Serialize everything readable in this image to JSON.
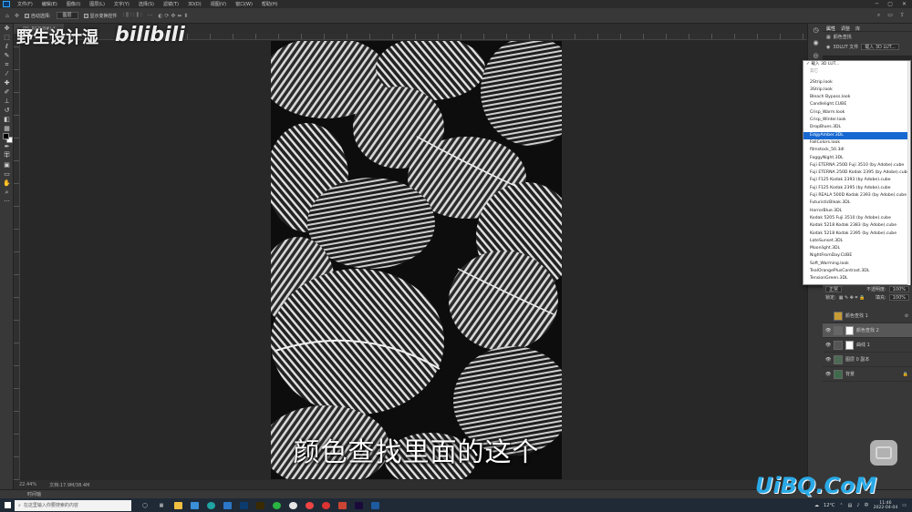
{
  "menu": {
    "items": [
      "文件(F)",
      "编辑(E)",
      "图像(I)",
      "图层(L)",
      "文字(Y)",
      "选择(S)",
      "滤镜(T)",
      "3D(D)",
      "视图(V)",
      "窗口(W)",
      "帮助(H)"
    ]
  },
  "options": {
    "auto_select": "自动选择:",
    "auto_select_value": "图层",
    "show_transform": "显示变换控件"
  },
  "document": {
    "tab": "0%,RGB/8#) *",
    "zoom": "22.44%",
    "doc_size": "文档:17.9M/38.4M"
  },
  "canvas": {
    "subtitle": "颜色查找里面的这个"
  },
  "watermark": {
    "channel": "野生设计湿",
    "bilibili": "bilibili",
    "site": "UiBQ.CoM"
  },
  "properties": {
    "tabs": [
      "属性",
      "调整",
      "库"
    ],
    "panel_title": "颜色查找",
    "lut_label": "3DLUT 文件",
    "lut_value": "载入 3D LUT..."
  },
  "dropdown": {
    "header_items": [
      "载入 3D LUT...",
      "其它"
    ],
    "items": [
      "2Strip.look",
      "3Strip.look",
      "Bleach Bypass.look",
      "Candlelight.CUBE",
      "Crisp_Warm.look",
      "Crisp_Winter.look",
      "DropBlues.3DL",
      "EdgyAmber.3DL",
      "FallColors.look",
      "filmstock_50.3dl",
      "FoggyNight.3DL",
      "Fuji ETERNA 250D Fuji 3510 (by Adobe).cube",
      "Fuji ETERNA 250D Kodak 2395 (by Adobe).cube",
      "Fuji F125 Kodak 2393 (by Adobe).cube",
      "Fuji F125 Kodak 2395 (by Adobe).cube",
      "Fuji REALA 500D Kodak 2393 (by Adobe).cube",
      "FuturisticBleak.3DL",
      "HorrorBlue.3DL",
      "Kodak 5205 Fuji 3510 (by Adobe).cube",
      "Kodak 5218 Kodak 2383 (by Adobe).cube",
      "Kodak 5218 Kodak 2395 (by Adobe).cube",
      "LateSunset.3DL",
      "Moonlight.3DL",
      "NightFromDay.CUBE",
      "Soft_Warming.look",
      "TealOrangePlusContrast.3DL",
      "TensionGreen.3DL"
    ],
    "highlighted_index": 7
  },
  "layers": {
    "blend_mode": "正常",
    "opacity_label": "不透明度:",
    "opacity_value": "100%",
    "lock_label": "锁定:",
    "fill_label": "填充:",
    "fill_value": "100%",
    "items": [
      {
        "name": "颜色查找 1",
        "visible": false,
        "active": false
      },
      {
        "name": "颜色查找 2",
        "visible": true,
        "active": true
      },
      {
        "name": "曲线 1",
        "visible": true,
        "active": false
      },
      {
        "name": "图层 0 副本",
        "visible": true,
        "active": false
      },
      {
        "name": "背景",
        "visible": true,
        "active": false
      }
    ]
  },
  "timeline": {
    "label": "时间轴"
  },
  "taskbar": {
    "search_placeholder": "在这里输入你要搜索的内容",
    "weather": "12°C",
    "time": "11:46",
    "date": "2022-04-04"
  },
  "colors": {
    "accent": "#1769d1",
    "site_blue": "#29a9e6"
  }
}
